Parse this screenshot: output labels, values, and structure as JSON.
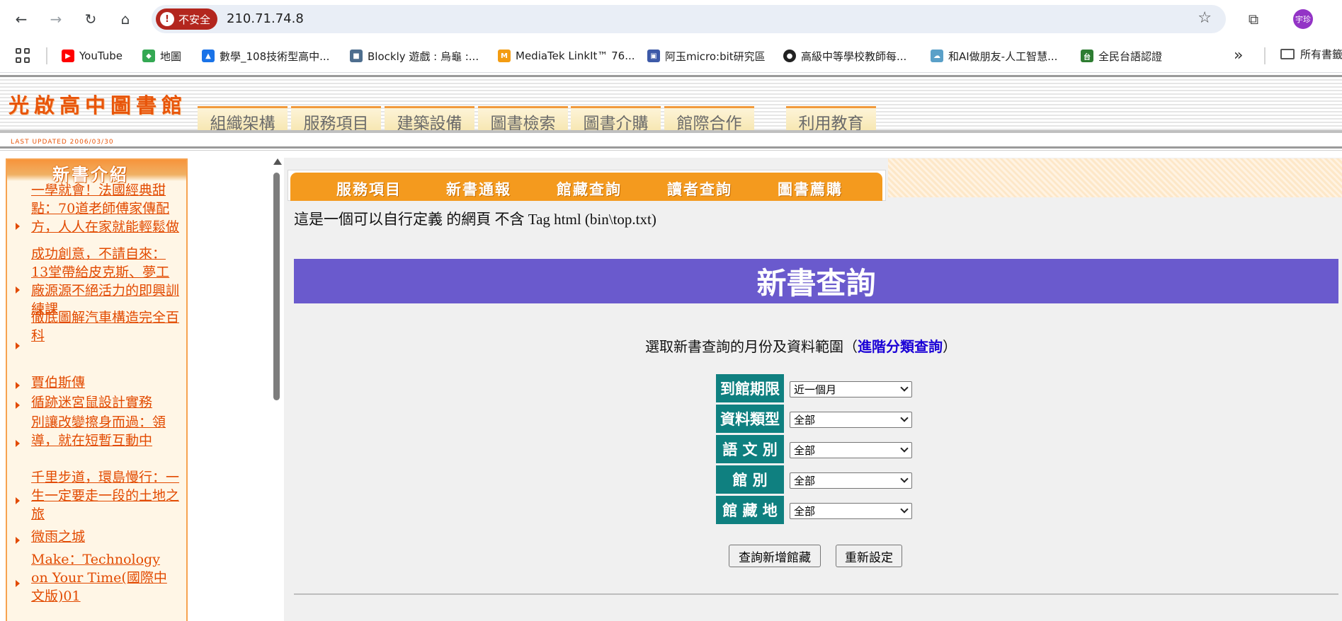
{
  "browser": {
    "security_label": "不安全",
    "url": "210.71.74.8",
    "profile_initials": "宇珍"
  },
  "bookmarks": [
    {
      "label": "YouTube",
      "color": "#ff0000",
      "icon": "youtube-icon"
    },
    {
      "label": "地圖",
      "color": "#34a853",
      "icon": "maps-icon"
    },
    {
      "label": "數學_108技術型高中...",
      "color": "#1a73e8",
      "icon": "math-icon"
    },
    {
      "label": "Blockly 遊戲 : 烏龜 :...",
      "color": "#4e6e8e",
      "icon": "blockly-icon"
    },
    {
      "label": "MediaTek LinkIt™ 76...",
      "color": "#f39c12",
      "icon": "mediatek-icon"
    },
    {
      "label": "阿玉micro:bit研究區",
      "color": "#3d5aa8",
      "icon": "microbit-icon"
    },
    {
      "label": "高級中等學校教師每...",
      "color": "#222222",
      "icon": "globe-icon"
    },
    {
      "label": "和AI做朋友-人工智慧...",
      "color": "#5aa0c8",
      "icon": "ai-icon"
    },
    {
      "label": "全民台語認證",
      "color": "#2e7d32",
      "icon": "taiwanese-icon"
    }
  ],
  "bookmarks_folder": "所有書籤",
  "site": {
    "logo": "光啟高中圖書館",
    "last_updated": "LAST UPDATED 2006/03/30",
    "menu": [
      "組織架構",
      "服務項目",
      "建築設備",
      "圖書檢索",
      "圖書介購",
      "館際合作",
      "利用教育"
    ]
  },
  "sidebar": {
    "title": "新書介紹",
    "books": [
      "一學就會！法國經典甜點：70道老師傅家傳配方，人人在家就能輕鬆做",
      "成功創意，不請自來：13堂帶給皮克斯、夢工廠源源不絕活力的即興訓練課",
      "徹底圖解汽車構造完全百科",
      "賈伯斯傳",
      "循跡迷宮鼠設計實務",
      "別讓改變擦身而過：領導，就在短暫互動中",
      "千里步道，環島慢行：一生一定要走一段的土地之旅",
      "微雨之城",
      "Make：Technology on Your Time(國際中文版)01"
    ]
  },
  "subnav": [
    "服務項目",
    "新書通報",
    "館藏查詢",
    "讀者查詢",
    "圖書薦購"
  ],
  "top_note": "這是一個可以自行定義 的網頁 不含 Tag html (bin\\top.txt)",
  "banner_title": "新書查詢",
  "intro": {
    "prefix": "選取新書查詢的月份及資料範圍（",
    "link": "進階分類查詢",
    "suffix": "）"
  },
  "form": [
    {
      "label": "到館期限",
      "value": "近一個月"
    },
    {
      "label": "資料類型",
      "value": "全部"
    },
    {
      "label": "語 文 別",
      "value": "全部"
    },
    {
      "label": "館 別",
      "value": "全部"
    },
    {
      "label": "館 藏 地",
      "value": "全部"
    }
  ],
  "buttons": {
    "submit": "查詢新增館藏",
    "reset": "重新設定"
  }
}
